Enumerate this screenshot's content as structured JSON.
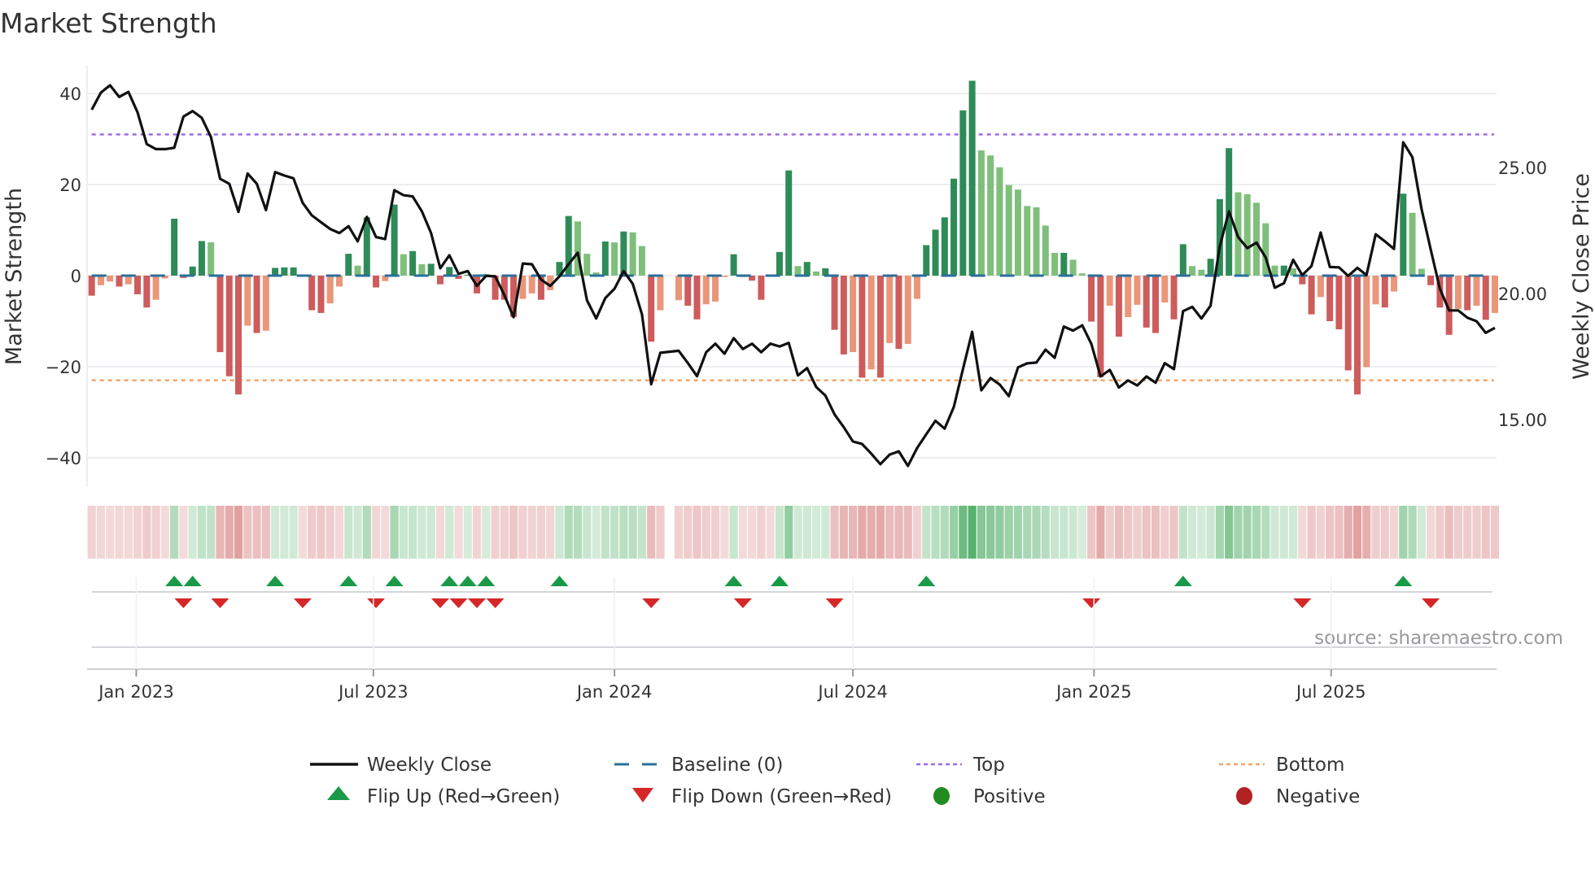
{
  "title": "Market Strength",
  "source_note": "source: sharemaestro.com",
  "chart_data": {
    "type": "bar",
    "title": "Market Strength",
    "ylabel": "Market Strength",
    "y2label": "Weekly Close Price",
    "ylim": [
      -47,
      47
    ],
    "y2lim": [
      12.4,
      27.75
    ],
    "yticks": [
      40,
      20,
      0,
      -20,
      -40
    ],
    "yticklabels": [
      "40",
      "20",
      "0",
      "−20",
      "−40"
    ],
    "y2ticks": [
      25,
      20,
      15
    ],
    "y2ticklabels": [
      "25.00",
      "20.00",
      "15.00"
    ],
    "x_start": "2022-11-28",
    "x_interval_days": 7,
    "xticks": [
      "2023-01-01",
      "2023-07-01",
      "2024-01-01",
      "2024-07-01",
      "2025-01-01",
      "2025-07-01"
    ],
    "xticklabels": [
      "Jan 2023",
      "Jul 2023",
      "Jan 2024",
      "Jul 2024",
      "Jan 2025",
      "Jul 2025"
    ],
    "top_level": 31,
    "bottom_level": -23,
    "baseline_level": 0,
    "grid": true,
    "legend_position": "bottom-center",
    "colors": {
      "pos_strong": "#2e8b57",
      "pos_weak": "#7fbf7b",
      "neg_strong": "#cd5c5c",
      "neg_weak": "#e9967a",
      "close": "#111111",
      "baseline": "#2a6f9b",
      "top": "#a06be0",
      "bottom": "#f0a468",
      "flip_up": "#1a9a48",
      "flip_down": "#d62728",
      "positive": "#228b22",
      "negative": "#b22222"
    },
    "series": [
      {
        "name": "Market Strength",
        "values": [
          -4.4,
          -2.1,
          -1.3,
          -2.4,
          -1.9,
          -4.1,
          -7.0,
          -5.3,
          -0.6,
          12.5,
          -0.5,
          2.0,
          7.6,
          7.3,
          -16.8,
          -22.1,
          -26.1,
          -11.0,
          -12.6,
          -12.1,
          1.7,
          1.8,
          1.8,
          -0.2,
          -7.6,
          -8.2,
          -6.1,
          -2.4,
          4.8,
          2.2,
          12.8,
          -2.6,
          -1.2,
          15.6,
          4.7,
          5.4,
          2.5,
          2.6,
          -1.9,
          1.9,
          -0.7,
          0.2,
          -3.9,
          0.3,
          -5.3,
          -5.3,
          -9.1,
          -5.1,
          -3.9,
          -5.3,
          -3.2,
          3.0,
          13.1,
          11.9,
          4.8,
          0.7,
          7.5,
          7.3,
          9.7,
          9.5,
          6.5,
          -14.5,
          -7.6,
          null,
          -5.4,
          -6.6,
          -9.6,
          -6.3,
          -5.7,
          -0.3,
          4.7,
          -0.3,
          -1.1,
          -5.3,
          -0.2,
          5.2,
          23.1,
          2.1,
          3.0,
          0.9,
          1.6,
          -11.9,
          -17.3,
          -16.8,
          -22.4,
          -20.6,
          -22.4,
          -14.8,
          -16.1,
          -15.0,
          -5.1,
          6.7,
          10.1,
          12.8,
          21.3,
          36.3,
          42.8,
          27.5,
          26.4,
          23.8,
          19.9,
          18.9,
          15.3,
          15.0,
          11.0,
          5.0,
          5.0,
          3.5,
          0.5,
          -10.1,
          -22.3,
          -6.6,
          -13.4,
          -9.1,
          -6.4,
          -11.4,
          -12.6,
          -5.9,
          -9.6,
          6.9,
          2.1,
          1.3,
          3.7,
          16.8,
          28.0,
          18.3,
          17.9,
          16.0,
          11.5,
          2.2,
          2.2,
          1.6,
          -1.9,
          -8.5,
          -4.7,
          -10.0,
          -11.8,
          -20.8,
          -26.1,
          -20.1,
          -6.3,
          -7.0,
          -3.5,
          18.0,
          13.8,
          1.5,
          -2.1,
          -7.0,
          -13.0,
          -7.3,
          -7.6,
          -6.6,
          -9.7,
          -8.2
        ]
      },
      {
        "name": "Weekly Close",
        "axis": "right",
        "values": [
          27.29,
          27.97,
          28.26,
          27.8,
          28.0,
          27.18,
          25.93,
          25.73,
          25.73,
          25.78,
          27.02,
          27.24,
          26.97,
          26.21,
          24.55,
          24.35,
          23.24,
          24.76,
          24.35,
          23.31,
          24.82,
          24.68,
          24.57,
          23.6,
          23.1,
          22.83,
          22.56,
          22.4,
          22.67,
          22.07,
          23.04,
          22.24,
          22.16,
          24.1,
          23.9,
          23.85,
          23.26,
          22.4,
          21.0,
          21.52,
          20.78,
          20.89,
          20.3,
          20.7,
          20.68,
          19.93,
          19.06,
          21.19,
          21.16,
          20.55,
          20.3,
          20.68,
          21.16,
          21.62,
          19.73,
          19.01,
          19.82,
          20.19,
          20.89,
          20.38,
          19.17,
          16.4,
          17.65,
          17.69,
          17.73,
          17.24,
          16.72,
          17.67,
          18.01,
          17.61,
          18.23,
          17.8,
          18.01,
          17.67,
          18.01,
          17.9,
          18.04,
          16.75,
          17.04,
          16.29,
          15.95,
          15.2,
          14.7,
          14.13,
          14.03,
          13.65,
          13.23,
          13.61,
          13.74,
          13.16,
          13.87,
          14.42,
          14.95,
          14.64,
          15.5,
          17.0,
          18.48,
          16.16,
          16.65,
          16.39,
          15.93,
          17.07,
          17.23,
          17.26,
          17.77,
          17.45,
          18.69,
          18.53,
          18.74,
          18.0,
          16.71,
          16.97,
          16.27,
          16.55,
          16.35,
          16.71,
          16.46,
          17.24,
          17.0,
          19.3,
          19.47,
          19.01,
          19.52,
          21.87,
          23.26,
          22.24,
          21.8,
          22.02,
          21.43,
          20.23,
          20.41,
          21.34,
          20.73,
          21.09,
          22.42,
          21.05,
          21.04,
          20.7,
          21.02,
          20.73,
          22.35,
          22.07,
          21.77,
          26.0,
          25.41,
          23.36,
          21.75,
          20.19,
          19.33,
          19.33,
          19.04,
          18.9,
          18.44,
          18.64
        ]
      }
    ]
  },
  "legend": [
    {
      "label": "Weekly Close",
      "kind": "line"
    },
    {
      "label": "Baseline (0)",
      "kind": "dash"
    },
    {
      "label": "Top",
      "kind": "top"
    },
    {
      "label": "Bottom",
      "kind": "bottom"
    },
    {
      "label": "Flip Up (Red→Green)",
      "kind": "up"
    },
    {
      "label": "Flip Down (Green→Red)",
      "kind": "down"
    },
    {
      "label": "Positive",
      "kind": "pos"
    },
    {
      "label": "Negative",
      "kind": "neg"
    }
  ]
}
